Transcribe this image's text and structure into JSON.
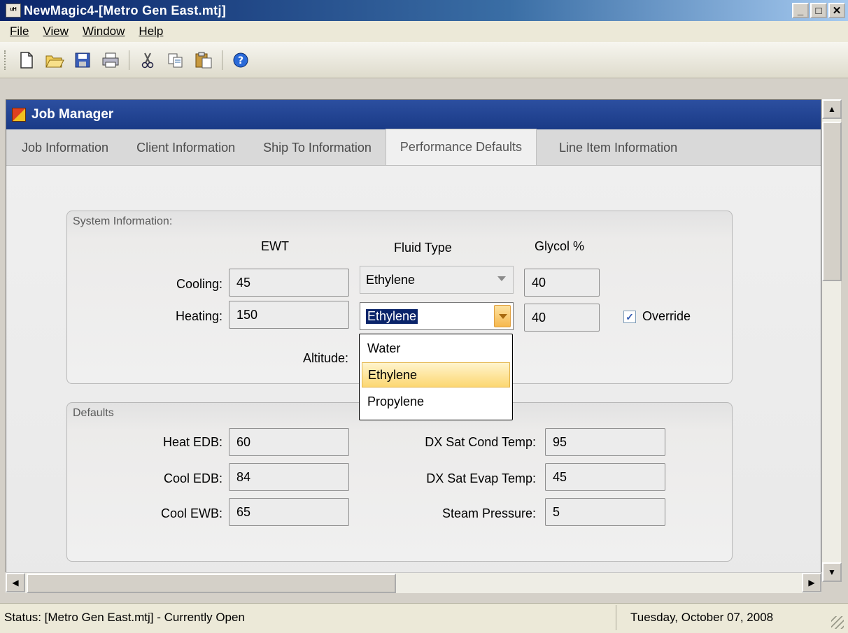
{
  "window": {
    "title": "NewMagic4-[Metro Gen East.mtj]",
    "app_icon_glyph": "ᵘᴴ",
    "controls": {
      "minimize": "_",
      "maximize": "□",
      "close": "✕"
    }
  },
  "menu": [
    {
      "label": "File"
    },
    {
      "label": "View"
    },
    {
      "label": "Window"
    },
    {
      "label": "Help"
    }
  ],
  "toolbar": {
    "icons": [
      "new-icon",
      "open-icon",
      "save-icon",
      "print-icon",
      "cut-icon",
      "copy-icon",
      "paste-icon",
      "help-icon"
    ]
  },
  "child": {
    "title": "Job Manager",
    "tabs": [
      {
        "label": "Job Information"
      },
      {
        "label": "Client Information"
      },
      {
        "label": "Ship To Information"
      },
      {
        "label": "Performance Defaults",
        "active": true
      },
      {
        "label": "Line Item Information"
      }
    ]
  },
  "system": {
    "title": "System Information:",
    "headers": {
      "ewt": "EWT",
      "fluid": "Fluid Type",
      "glycol": "Glycol %"
    },
    "cooling": {
      "label": "Cooling:",
      "ewt": "45",
      "fluid": "Ethylene",
      "glycol": "40"
    },
    "heating": {
      "label": "Heating:",
      "ewt": "150",
      "fluid": "Ethylene",
      "glycol": "40"
    },
    "override": {
      "label": "Override",
      "checked": true
    },
    "altitude": {
      "label": "Altitude:"
    },
    "dropdown": {
      "options": [
        "Water",
        "Ethylene",
        "Propylene"
      ],
      "highlighted": "Ethylene"
    }
  },
  "defaults": {
    "title": "Defaults",
    "heat_edb": {
      "label": "Heat EDB:",
      "value": "60"
    },
    "cool_edb": {
      "label": "Cool EDB:",
      "value": "84"
    },
    "cool_ewb": {
      "label": "Cool EWB:",
      "value": "65"
    },
    "dx_cond": {
      "label": "DX Sat Cond Temp:",
      "value": "95"
    },
    "dx_evap": {
      "label": "DX Sat Evap Temp:",
      "value": "45"
    },
    "steam": {
      "label": "Steam Pressure:",
      "value": "5"
    }
  },
  "status": {
    "left": "Status: [Metro Gen East.mtj] - Currently Open",
    "right": "Tuesday, October 07, 2008"
  },
  "colors": {
    "title_bar": "#0a246a",
    "child_title": "#1a3a86",
    "dropdown_highlight": "#fcd772"
  }
}
